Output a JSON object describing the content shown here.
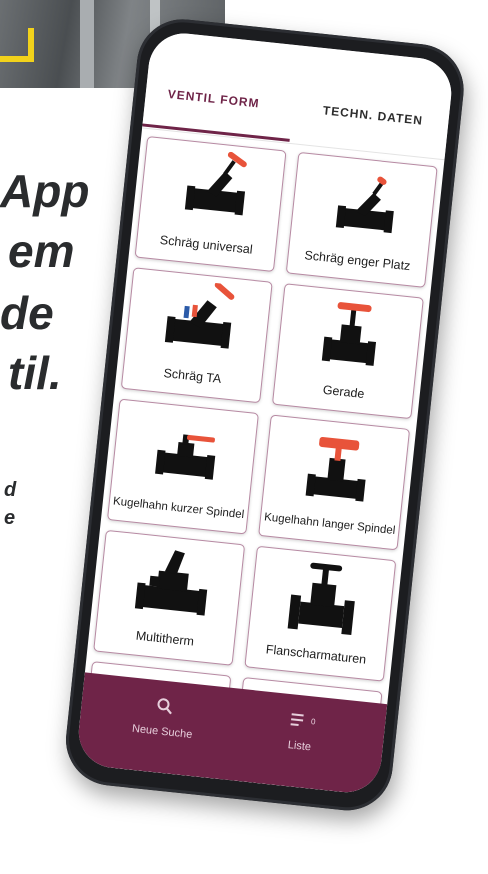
{
  "promo": {
    "line1": "App",
    "line2": "em",
    "line3": "de",
    "line4": "til.",
    "line5": "d",
    "line6": "e"
  },
  "tabs": [
    {
      "label": "VENTIL FORM",
      "active": true
    },
    {
      "label": "TECHN. DATEN",
      "active": false
    }
  ],
  "tiles": [
    {
      "label": "Schräg universal",
      "icon": "angled-valve-icon"
    },
    {
      "label": "Schräg enger Platz",
      "icon": "angled-valve-compact-icon"
    },
    {
      "label": "Schräg TA",
      "icon": "angled-valve-ta-icon"
    },
    {
      "label": "Gerade",
      "icon": "straight-valve-icon"
    },
    {
      "label": "Kugelhahn kurzer Spindel",
      "icon": "ball-valve-short-icon"
    },
    {
      "label": "Kugelhahn langer Spindel",
      "icon": "ball-valve-long-icon"
    },
    {
      "label": "Multitherm",
      "icon": "multitherm-valve-icon"
    },
    {
      "label": "Flanscharmaturen",
      "icon": "flanged-valve-icon"
    }
  ],
  "bottom_nav": {
    "search_label": "Neue Suche",
    "list_label": "Liste",
    "list_count": "0"
  },
  "colors": {
    "accent": "#6f2448",
    "handle_red": "#e8533a",
    "tile_border": "#b78aa3"
  }
}
